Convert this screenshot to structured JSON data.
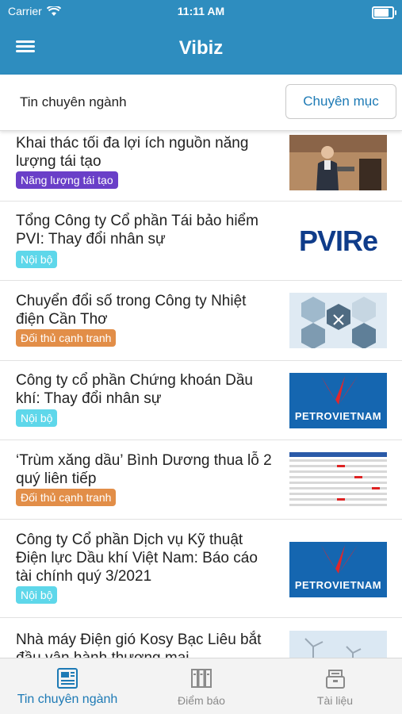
{
  "status": {
    "carrier": "Carrier",
    "time": "11:11 AM"
  },
  "header": {
    "title": "Vibiz"
  },
  "filter": {
    "label": "Tin chuyên ngành",
    "category_button": "Chuyên mục"
  },
  "tag_colors": {
    "Năng lượng tái tạo": "#6a3fc8",
    "Nội bộ": "#5ed7ea",
    "Đối thủ cạnh tranh": "#e28e48"
  },
  "articles": [
    {
      "title": "Khai thác tối đa lợi ích nguồn năng lượng tái tạo",
      "tag": "Năng lượng tái tạo",
      "thumb": "speaker-photo"
    },
    {
      "title": "Tổng Công ty Cổ phần Tái bảo hiểm PVI: Thay đổi nhân sự",
      "tag": "Nội bộ",
      "thumb": "pvire-logo",
      "thumb_text": "PVIRe"
    },
    {
      "title": "Chuyển đổi số trong Công ty Nhiệt điện Cần Thơ",
      "tag": "Đối thủ cạnh tranh",
      "thumb": "digital-hexagons"
    },
    {
      "title": "Công ty cổ phần Chứng khoán Dầu khí: Thay đổi nhân sự",
      "tag": "Nội bộ",
      "thumb": "petrovietnam-logo",
      "thumb_text": "PETROVIETNAM"
    },
    {
      "title": "‘Trùm xăng dầu’ Bình Dương thua lỗ 2 quý liên tiếp",
      "tag": "Đối thủ cạnh tranh",
      "thumb": "financial-table"
    },
    {
      "title": "Công ty Cổ phần Dịch vụ Kỹ thuật Điện lực Dầu khí Việt Nam: Báo cáo tài chính quý 3/2021",
      "tag": "Nội bộ",
      "thumb": "petrovietnam-logo",
      "thumb_text": "PETROVIETNAM"
    },
    {
      "title": "Nhà máy Điện gió Kosy Bạc Liêu bắt đầu vận hành thương mại",
      "tag": "",
      "thumb": "wind-farm"
    }
  ],
  "tabs": [
    {
      "label": "Tin chuyên ngành",
      "icon": "newspaper-icon",
      "active": true
    },
    {
      "label": "Điểm báo",
      "icon": "news-digest-icon",
      "active": false
    },
    {
      "label": "Tài liệu",
      "icon": "archive-box-icon",
      "active": false
    }
  ],
  "colors": {
    "header": "#2e8dbf",
    "accent": "#1d7ab5",
    "inactive_tab": "#8a8a8a"
  }
}
